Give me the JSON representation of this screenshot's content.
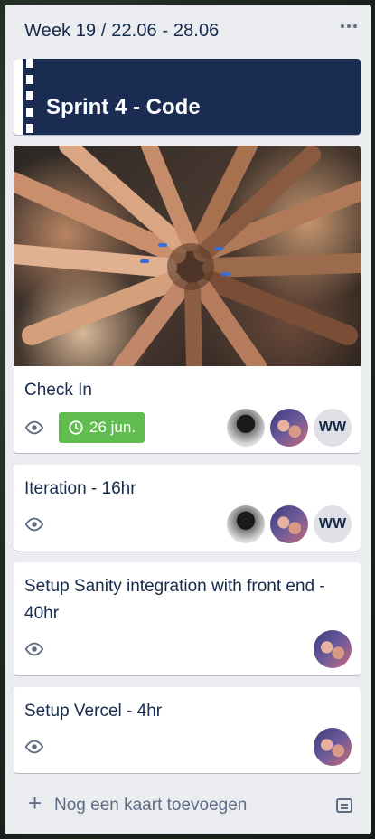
{
  "list": {
    "title": "Week 19 / 22.06 - 28.06",
    "menu_icon": "more-horizontal-icon",
    "add_card_label": "Nog een kaart toevoegen",
    "template_icon": "card-template-icon"
  },
  "banner": {
    "title": "Sprint 4 - Code"
  },
  "cards": [
    {
      "title": "Check In",
      "has_cover": true,
      "watching": true,
      "due": "26 jun.",
      "due_color": "#61bd4f",
      "members": [
        "avatar-bw",
        "avatar-duo",
        "WW"
      ]
    },
    {
      "title": "Iteration - 16hr",
      "watching": true,
      "members": [
        "avatar-bw",
        "avatar-duo",
        "WW"
      ]
    },
    {
      "title": "Setup Sanity integration with front end - 40hr",
      "watching": true,
      "members": [
        "avatar-duo"
      ]
    },
    {
      "title": "Setup Vercel - 4hr",
      "watching": true,
      "members": [
        "avatar-duo"
      ]
    }
  ],
  "member_initials": "WW",
  "colors": {
    "list_bg": "#ebecf0",
    "banner_bg": "#1a2c51",
    "due_green": "#61bd4f",
    "text": "#172b4d",
    "muted": "#5e6c84"
  }
}
